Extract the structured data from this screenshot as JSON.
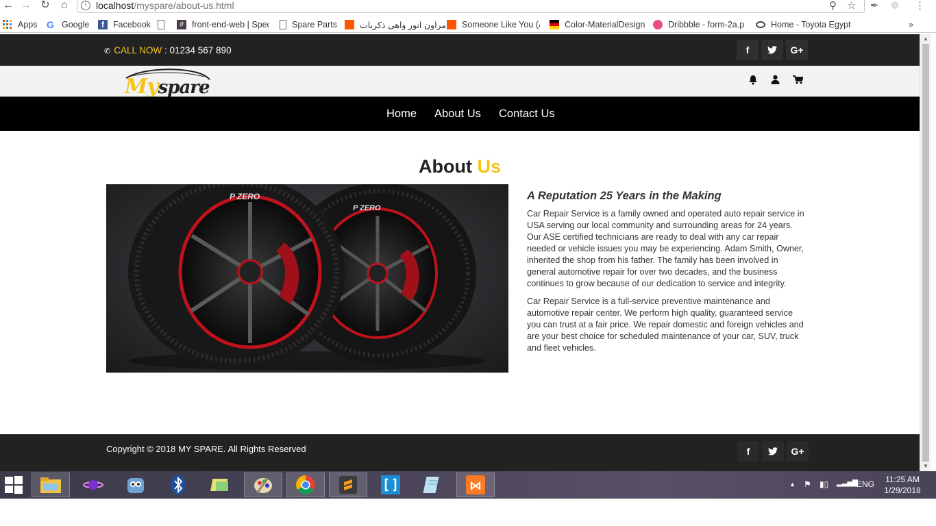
{
  "browser": {
    "url_host": "localhost",
    "url_path": "/myspare/about-us.html",
    "bookmarks": [
      {
        "label": "Apps",
        "icon": "apps-grid-icon"
      },
      {
        "label": "Google",
        "icon": "google-icon"
      },
      {
        "label": "Facebook",
        "icon": "facebook-icon"
      },
      {
        "label": "",
        "icon": "page-icon"
      },
      {
        "label": "front-end-web | Spec",
        "icon": "slack-icon"
      },
      {
        "label": "Spare Parts",
        "icon": "page-icon"
      },
      {
        "label": "مراون انور واهى ذكريات",
        "icon": "soundcloud-icon"
      },
      {
        "label": "Someone Like You (A",
        "icon": "soundcloud-icon"
      },
      {
        "label": "Color-MaterialDesign",
        "icon": "flag-icon"
      },
      {
        "label": "Dribbble - form-2a.p",
        "icon": "dribbble-icon"
      },
      {
        "label": "Home - Toyota Egypt",
        "icon": "toyota-icon"
      }
    ]
  },
  "topbar": {
    "call_label": "CALL NOW",
    "phone": " : 01234 567 890"
  },
  "brand": {
    "logo_first": "My",
    "logo_second": "spare"
  },
  "nav": {
    "home": "Home",
    "about": "About Us",
    "contact": "Contact Us"
  },
  "about": {
    "title_main": "About ",
    "title_accent": "Us",
    "heading": "A Reputation 25 Years in the Making",
    "paragraph1": "Car Repair Service is a family owned and operated auto repair service in USA serving our local community and surrounding areas for 24 years. Our ASE certified technicians are ready to deal with any car repair needed or vehicle issues you may be experiencing. Adam Smith, Owner, inherited the shop from his father. The family has been involved in general automotive repair for over two decades, and the business continues to grow because of our dedication to service and integrity.",
    "paragraph2": "Car Repair Service is a full-service preventive maintenance and automotive repair center. We perform high quality, guaranteed service you can trust at a fair price. We repair domestic and foreign vehicles and are your best choice for scheduled maintenance of your car, SUV, truck and fleet vehicles.",
    "tire_brand": "P ZERO"
  },
  "footer": {
    "copyright": "Copyright © 2018 MY SPARE. All Rights Reserved"
  },
  "social": {
    "facebook": "f",
    "google_plus": "G+"
  },
  "taskbar": {
    "language": "ENG",
    "time": "11:25 AM",
    "date": "1/29/2018"
  },
  "colors": {
    "accent": "#f5c518",
    "dark": "#222222",
    "nav": "#000000"
  }
}
